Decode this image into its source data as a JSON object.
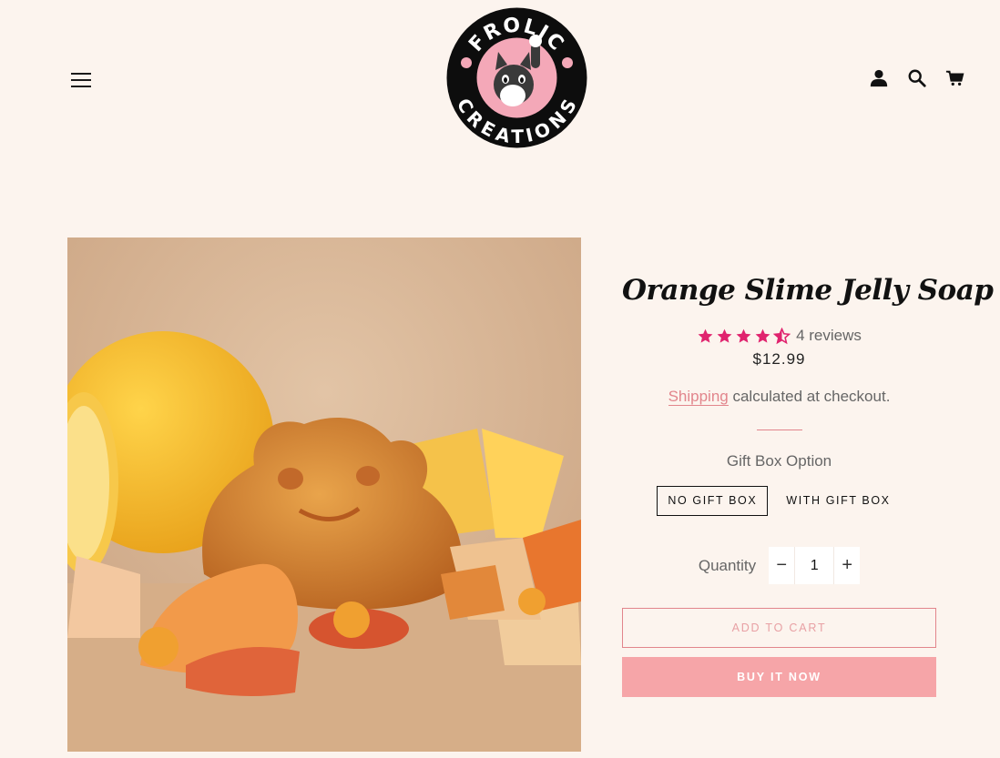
{
  "brand": {
    "logo_top_text": "FROLIC",
    "logo_bottom_text": "CREATIONS",
    "colors": {
      "accent": "#e2858c",
      "button_fill": "#f6a5a8",
      "star": "#e0236e",
      "background": "#fcf4ee"
    }
  },
  "header": {
    "icons": [
      "menu-icon",
      "account-icon",
      "search-icon",
      "cart-icon"
    ]
  },
  "product": {
    "title": "Orange Slime Jelly Soap",
    "rating": 4.5,
    "reviews_label": "4 reviews",
    "price": "$12.99",
    "shipping_link": "Shipping",
    "shipping_rest": " calculated at checkout.",
    "option_label": "Gift Box Option",
    "options": [
      "NO GIFT BOX",
      "WITH GIFT BOX"
    ],
    "selected_option": "NO GIFT BOX",
    "quantity_label": "Quantity",
    "quantity_value": "1",
    "minus_symbol": "−",
    "plus_symbol": "+",
    "add_to_cart": "ADD TO CART",
    "buy_now": "BUY IT NOW"
  }
}
